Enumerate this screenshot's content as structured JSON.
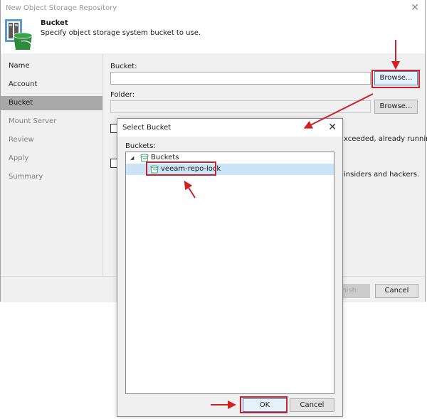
{
  "wizard": {
    "title": "New Object Storage Repository",
    "close_glyph": "✕",
    "header": {
      "icon": "object-storage-bucket-icon",
      "step_title": "Bucket",
      "step_description": "Specify object storage system bucket to use."
    },
    "nav": [
      {
        "label": "Name",
        "state": "done"
      },
      {
        "label": "Account",
        "state": "done"
      },
      {
        "label": "Bucket",
        "state": "active"
      },
      {
        "label": "Mount Server",
        "state": "pending"
      },
      {
        "label": "Review",
        "state": "pending"
      },
      {
        "label": "Apply",
        "state": "pending"
      },
      {
        "label": "Summary",
        "state": "pending"
      }
    ],
    "content": {
      "bucket_label": "Bucket:",
      "bucket_value": "",
      "bucket_browse": "Browse...",
      "folder_label": "Folder:",
      "folder_value": "",
      "folder_browse": "Browse...",
      "option1_partial_text": "xceeded, already running",
      "option2_partial_text": "insiders and hackers."
    },
    "footer": {
      "finish_partial": "nish",
      "cancel": "Cancel"
    }
  },
  "dialog": {
    "title": "Select Bucket",
    "close_glyph": "✕",
    "list_label": "Buckets:",
    "tree": [
      {
        "label": "Buckets",
        "level": 0,
        "expanded": true,
        "selected": false,
        "icon": "bucket-icon"
      },
      {
        "label": "veeam-repo-lock",
        "level": 1,
        "selected": true,
        "icon": "bucket-icon"
      }
    ],
    "ok": "OK",
    "cancel": "Cancel"
  },
  "annotations": {
    "highlight_color": "#c8232c"
  }
}
